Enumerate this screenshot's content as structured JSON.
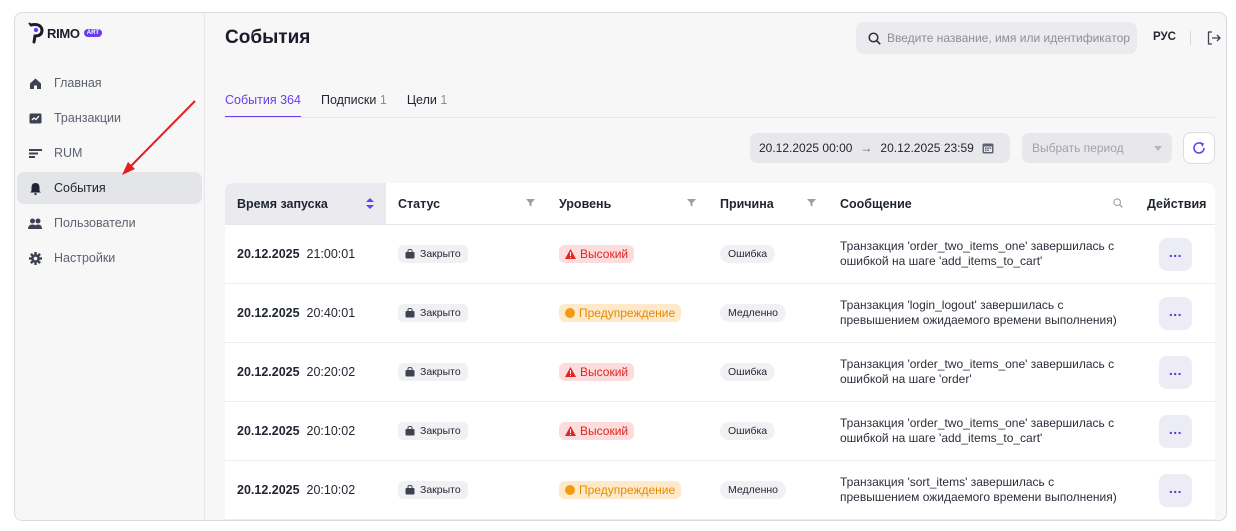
{
  "brand": {
    "name": "RIMO",
    "initial": "P",
    "badge": "ART",
    "accent": "#6a3df0"
  },
  "sidebar": {
    "items": [
      {
        "label": "Главная",
        "icon": "home-icon",
        "active": false
      },
      {
        "label": "Транзакции",
        "icon": "transactions-icon",
        "active": false
      },
      {
        "label": "RUM",
        "icon": "rum-icon",
        "active": false
      },
      {
        "label": "События",
        "icon": "bell-icon",
        "active": true
      },
      {
        "label": "Пользователи",
        "icon": "users-icon",
        "active": false
      },
      {
        "label": "Настройки",
        "icon": "gear-icon",
        "active": false
      }
    ]
  },
  "header": {
    "title": "События",
    "search_placeholder": "Введите название, имя или идентификатор",
    "language": "РУС"
  },
  "tabs": [
    {
      "label": "События",
      "count": "364",
      "active": true
    },
    {
      "label": "Подписки",
      "count": "1",
      "active": false
    },
    {
      "label": "Цели",
      "count": "1",
      "active": false
    }
  ],
  "filters": {
    "date_from": "20.12.2025 00:00",
    "date_to": "20.12.2025 23:59",
    "period_placeholder": "Выбрать период"
  },
  "table": {
    "columns": [
      "Время запуска",
      "Статус",
      "Уровень",
      "Причина",
      "Сообщение",
      "Действия"
    ],
    "rows": [
      {
        "date": "20.12.2025",
        "time": "21:00:01",
        "status": "Закрыто",
        "level": "Высокий",
        "level_kind": "high",
        "reason": "Ошибка",
        "message": "Транзакция 'order_two_items_one' завершилась с ошибкой на шаге 'add_items_to_cart'"
      },
      {
        "date": "20.12.2025",
        "time": "20:40:01",
        "status": "Закрыто",
        "level": "Предупреждение",
        "level_kind": "warn",
        "reason": "Медленно",
        "message": "Транзакция 'login_logout' завершилась с превышением ожидаемого времени выполнения)"
      },
      {
        "date": "20.12.2025",
        "time": "20:20:02",
        "status": "Закрыто",
        "level": "Высокий",
        "level_kind": "high",
        "reason": "Ошибка",
        "message": "Транзакция 'order_two_items_one' завершилась с ошибкой на шаге 'order'"
      },
      {
        "date": "20.12.2025",
        "time": "20:10:02",
        "status": "Закрыто",
        "level": "Высокий",
        "level_kind": "high",
        "reason": "Ошибка",
        "message": "Транзакция 'order_two_items_one' завершилась с ошибкой на шаге 'add_items_to_cart'"
      },
      {
        "date": "20.12.2025",
        "time": "20:10:02",
        "status": "Закрыто",
        "level": "Предупреждение",
        "level_kind": "warn",
        "reason": "Медленно",
        "message": "Транзакция 'sort_items' завершилась с превышением ожидаемого времени выполнения)"
      }
    ]
  },
  "colors": {
    "high_bg": "#fcdcdc",
    "high_fg": "#e0261f",
    "warn_bg": "#feeacb",
    "warn_fg": "#e58a00",
    "annotation_arrow": "#e02020"
  }
}
